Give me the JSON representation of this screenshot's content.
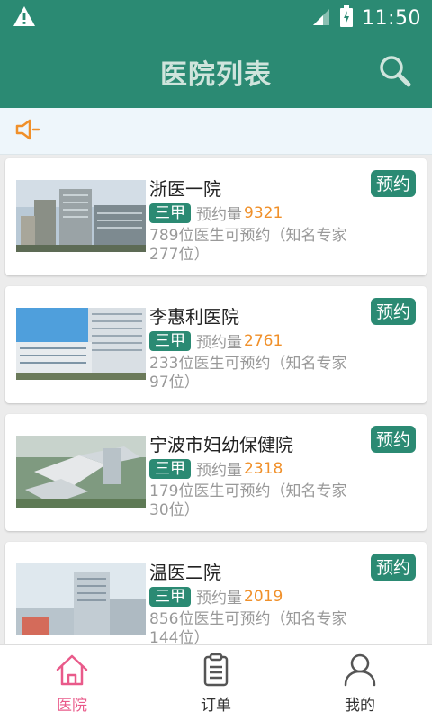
{
  "status_bar": {
    "time": "11:50"
  },
  "app_bar": {
    "title": "医院列表"
  },
  "hospitals": [
    {
      "name": "浙医一院",
      "level": "三甲",
      "booking_label": "预约量",
      "booking_count": "9321",
      "description": "789位医生可预约（知名专家277位）",
      "book_label": "预约"
    },
    {
      "name": "李惠利医院",
      "level": "三甲",
      "booking_label": "预约量",
      "booking_count": "2761",
      "description": "233位医生可预约（知名专家97位）",
      "book_label": "预约"
    },
    {
      "name": "宁波市妇幼保健院",
      "level": "三甲",
      "booking_label": "预约量",
      "booking_count": "2318",
      "description": "179位医生可预约（知名专家30位）",
      "book_label": "预约"
    },
    {
      "name": "温医二院",
      "level": "三甲",
      "booking_label": "预约量",
      "booking_count": "2019",
      "description": "856位医生可预约（知名专家144位）",
      "book_label": "预约"
    }
  ],
  "tabs": [
    {
      "label": "医院",
      "icon": "home-icon",
      "active": true
    },
    {
      "label": "订单",
      "icon": "clipboard-icon",
      "active": false
    },
    {
      "label": "我的",
      "icon": "user-icon",
      "active": false
    }
  ],
  "colors": {
    "primary": "#2b8a73",
    "accent": "#f0902a",
    "active_tab": "#e95a8a"
  }
}
